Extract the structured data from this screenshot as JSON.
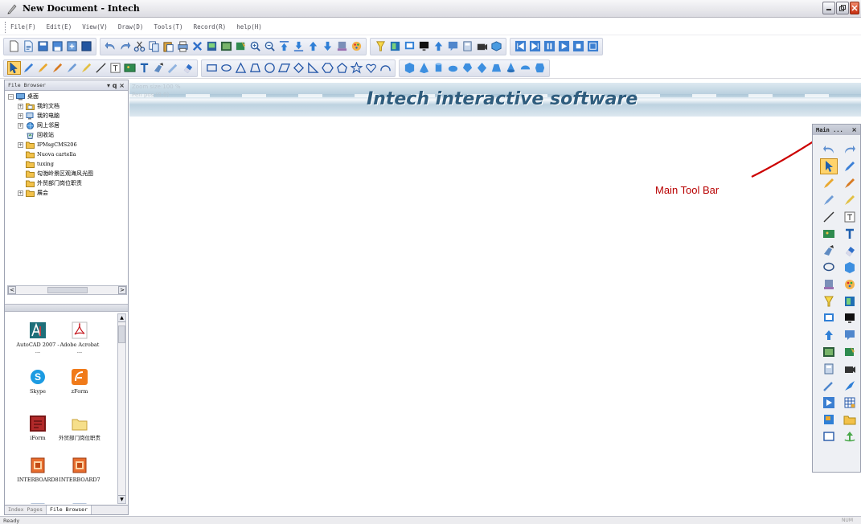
{
  "window": {
    "title": "New Document - Intech",
    "controls": [
      "minimize",
      "restore",
      "close"
    ]
  },
  "menu": [
    "File(F)",
    "Edit(E)",
    "View(V)",
    "Draw(D)",
    "Tools(T)",
    "Record(R)",
    "help(H)"
  ],
  "file_browser": {
    "title": "File Browser",
    "controls": "▾ q ×",
    "tree": [
      {
        "label": "桌面",
        "expand": "−",
        "depth": 0,
        "icon": "desktop-icon"
      },
      {
        "label": "我的文档",
        "expand": "+",
        "depth": 1,
        "icon": "documents-icon"
      },
      {
        "label": "我的电脑",
        "expand": "+",
        "depth": 1,
        "icon": "computer-icon"
      },
      {
        "label": "网上邻居",
        "expand": "+",
        "depth": 1,
        "icon": "network-icon"
      },
      {
        "label": "回收站",
        "expand": "",
        "depth": 1,
        "icon": "recycle-bin-icon"
      },
      {
        "label": "IPMsgCMS206",
        "expand": "+",
        "depth": 1,
        "icon": "folder-icon"
      },
      {
        "label": "Nuova cartella",
        "expand": "",
        "depth": 1,
        "icon": "folder-icon"
      },
      {
        "label": "tuxing",
        "expand": "",
        "depth": 1,
        "icon": "folder-icon"
      },
      {
        "label": "勾渤岭景区观海风光图",
        "expand": "",
        "depth": 1,
        "icon": "folder-icon"
      },
      {
        "label": "外贸部门岗位职责",
        "expand": "",
        "depth": 1,
        "icon": "folder-icon"
      },
      {
        "label": "展会",
        "expand": "+",
        "depth": 1,
        "icon": "folder-icon"
      }
    ],
    "apps": [
      {
        "label": "AutoCAD 2007 - ...",
        "icon": "autocad-icon"
      },
      {
        "label": "Adobe Acrobat ...",
        "icon": "acrobat-icon"
      },
      {
        "label": "Skype",
        "icon": "skype-icon"
      },
      {
        "label": "zForm",
        "icon": "zform-icon"
      },
      {
        "label": "iForm",
        "icon": "iform-icon"
      },
      {
        "label": "外贸部门岗位职责",
        "icon": "folder-icon"
      },
      {
        "label": "INTERBOARD8",
        "icon": "interboard-icon"
      },
      {
        "label": "INTERBOARD7",
        "icon": "interboard-icon"
      },
      {
        "label": "",
        "icon": "document-icon"
      },
      {
        "label": "",
        "icon": "document-icon"
      }
    ],
    "tabs": [
      "Index Pages",
      "File Browser"
    ],
    "active_tab": "File Browser"
  },
  "canvas": {
    "zoom_label": "Zoom size:100 %",
    "pos_label": "Pen pos:(0,0)",
    "banner_title": "Intech interactive software"
  },
  "main_toolbar": {
    "title": "Main ...",
    "close": "×"
  },
  "annotation": {
    "label": "Main Tool Bar",
    "color": "#b80000"
  },
  "status": {
    "text": "Ready",
    "right": "NUM"
  },
  "colors": {
    "title_text": "#2f5d7e",
    "accent_blue": "#2f7fd6",
    "highlight": "#ffd36b"
  }
}
